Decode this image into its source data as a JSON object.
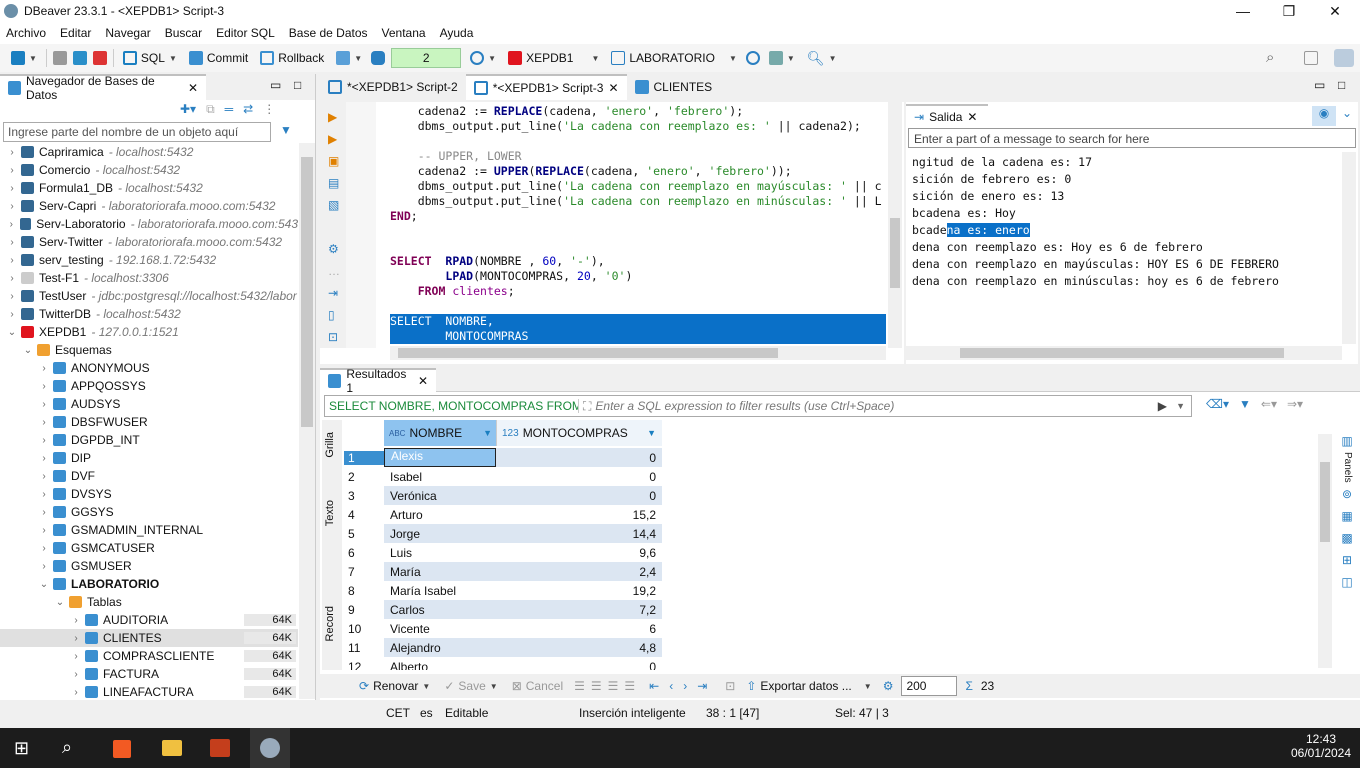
{
  "window": {
    "title": "DBeaver 23.3.1 - <XEPDB1> Script-3"
  },
  "menu": [
    "Archivo",
    "Editar",
    "Navegar",
    "Buscar",
    "Editor SQL",
    "Base de Datos",
    "Ventana",
    "Ayuda"
  ],
  "toolbar": {
    "sql": "SQL",
    "commit": "Commit",
    "rollback": "Rollback",
    "tx_count": "2",
    "connection": "XEPDB1",
    "schema": "LABORATORIO"
  },
  "navigator": {
    "tab": "Navegador de Bases de Datos",
    "filter_placeholder": "Ingrese parte del nombre de un objeto aquí",
    "items": [
      {
        "label": "Capriramica",
        "host": "- localhost:5432",
        "level": 0,
        "type": "pg"
      },
      {
        "label": "Comercio",
        "host": "- localhost:5432",
        "level": 0,
        "type": "pg"
      },
      {
        "label": "Formula1_DB",
        "host": "- localhost:5432",
        "level": 0,
        "type": "pg"
      },
      {
        "label": "Serv-Capri",
        "host": "- laboratoriorafa.mooo.com:5432",
        "level": 0,
        "type": "pg"
      },
      {
        "label": "Serv-Laboratorio",
        "host": "- laboratoriorafa.mooo.com:543",
        "level": 0,
        "type": "pg"
      },
      {
        "label": "Serv-Twitter",
        "host": "- laboratoriorafa.mooo.com:5432",
        "level": 0,
        "type": "pg"
      },
      {
        "label": "serv_testing",
        "host": "- 192.168.1.72:5432",
        "level": 0,
        "type": "pg"
      },
      {
        "label": "Test-F1",
        "host": "- localhost:3306",
        "level": 0,
        "type": "mysql"
      },
      {
        "label": "TestUser",
        "host": "- jdbc:postgresql://localhost:5432/labor",
        "level": 0,
        "type": "pg"
      },
      {
        "label": "TwitterDB",
        "host": "- localhost:5432",
        "level": 0,
        "type": "pg"
      },
      {
        "label": "XEPDB1",
        "host": "- 127.0.0.1:1521",
        "level": 0,
        "type": "oracle",
        "open": true
      },
      {
        "label": "Esquemas",
        "level": 1,
        "type": "folder",
        "open": true
      },
      {
        "label": "ANONYMOUS",
        "level": 2,
        "type": "schema"
      },
      {
        "label": "APPQOSSYS",
        "level": 2,
        "type": "schema"
      },
      {
        "label": "AUDSYS",
        "level": 2,
        "type": "schema"
      },
      {
        "label": "DBSFWUSER",
        "level": 2,
        "type": "schema"
      },
      {
        "label": "DGPDB_INT",
        "level": 2,
        "type": "schema"
      },
      {
        "label": "DIP",
        "level": 2,
        "type": "schema"
      },
      {
        "label": "DVF",
        "level": 2,
        "type": "schema"
      },
      {
        "label": "DVSYS",
        "level": 2,
        "type": "schema"
      },
      {
        "label": "GGSYS",
        "level": 2,
        "type": "schema"
      },
      {
        "label": "GSMADMIN_INTERNAL",
        "level": 2,
        "type": "schema"
      },
      {
        "label": "GSMCATUSER",
        "level": 2,
        "type": "schema"
      },
      {
        "label": "GSMUSER",
        "level": 2,
        "type": "schema"
      },
      {
        "label": "LABORATORIO",
        "level": 2,
        "type": "schema",
        "open": true,
        "bold": true
      },
      {
        "label": "Tablas",
        "level": 3,
        "type": "folder",
        "open": true
      },
      {
        "label": "AUDITORIA",
        "level": 4,
        "type": "table",
        "size": "64K"
      },
      {
        "label": "CLIENTES",
        "level": 4,
        "type": "table",
        "size": "64K",
        "selected": true
      },
      {
        "label": "COMPRASCLIENTE",
        "level": 4,
        "type": "table",
        "size": "64K"
      },
      {
        "label": "FACTURA",
        "level": 4,
        "type": "table",
        "size": "64K"
      },
      {
        "label": "LINEAFACTURA",
        "level": 4,
        "type": "table",
        "size": "64K"
      }
    ]
  },
  "editor_tabs": [
    "*<XEPDB1> Script-2",
    "*<XEPDB1> Script-3",
    "CLIENTES"
  ],
  "output": {
    "tab": "Salida",
    "search_placeholder": "Enter a part of a message to search for here",
    "lines": [
      "ngitud de la cadena es: 17",
      "sición de febrero es: 0",
      "sición de enero es: 13",
      "bcadena es: Hoy",
      "bcadena es: enero",
      "dena con reemplazo es: Hoy es 6 de febrero",
      "dena con reemplazo en mayúsculas: HOY ES 6 DE FEBRERO",
      "dena con reemplazo en minúsculas: hoy es 6 de febrero"
    ]
  },
  "results": {
    "tab": "Resultados 1",
    "query": "SELECT NOMBRE, MONTOCOMPRAS FROM",
    "filter_placeholder": "Enter a SQL expression to filter results (use Ctrl+Space)",
    "columns": [
      "NOMBRE",
      "MONTOCOMPRAS"
    ],
    "col_types": [
      "ABC",
      "123"
    ],
    "rows": [
      [
        "Alexis",
        "0"
      ],
      [
        "Isabel",
        "0"
      ],
      [
        "Verónica",
        "0"
      ],
      [
        "Arturo",
        "15,2"
      ],
      [
        "Jorge",
        "14,4"
      ],
      [
        "Luis",
        "9,6"
      ],
      [
        "María",
        "2,4"
      ],
      [
        "María Isabel",
        "19,2"
      ],
      [
        "Carlos",
        "7,2"
      ],
      [
        "Vicente",
        "6"
      ],
      [
        "Alejandro",
        "4,8"
      ],
      [
        "Alberto",
        "0"
      ]
    ],
    "side_tabs": [
      "Grilla",
      "Texto",
      "Record"
    ],
    "panels": "Panels",
    "bottom": {
      "refresh": "Renovar",
      "save": "Save",
      "cancel": "Cancel",
      "export": "Exportar datos ...",
      "fetch_size": "200",
      "row_count": "23"
    }
  },
  "status": {
    "tz": "CET",
    "lang": "es",
    "mode": "Editable",
    "insert": "Inserción inteligente",
    "pos": "38 : 1 [47]",
    "sel": "Sel: 47 | 3"
  },
  "taskbar": {
    "time": "12:43",
    "date": "06/01/2024"
  }
}
